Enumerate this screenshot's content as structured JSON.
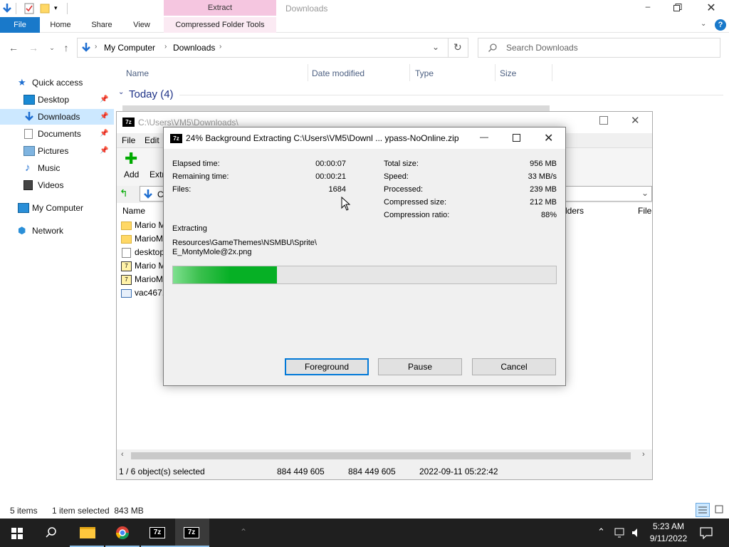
{
  "explorer": {
    "ribbon_context_label": "Extract",
    "window_title": "Downloads",
    "tabs": [
      "File",
      "Home",
      "Share",
      "View",
      "Compressed Folder Tools"
    ],
    "breadcrumb": [
      "My Computer",
      "Downloads"
    ],
    "search_placeholder": "Search Downloads",
    "columns": [
      "Name",
      "Date modified",
      "Type",
      "Size"
    ],
    "group_label": "Today (4)",
    "nav": {
      "quick_access": "Quick access",
      "items": [
        "Desktop",
        "Downloads",
        "Documents",
        "Pictures",
        "Music",
        "Videos"
      ],
      "my_computer": "My Computer",
      "network": "Network"
    },
    "status": {
      "items": "5 items",
      "selected": "1 item selected  843 MB"
    }
  },
  "sevenzip": {
    "title": "C:\\Users\\VM5\\Downloads\\",
    "menu": [
      "File",
      "Edit"
    ],
    "toolbar": {
      "add": "Add",
      "extract": "Extr"
    },
    "path_short": "C",
    "name_header": "Name",
    "folders_header": "lders",
    "file_header": "File",
    "files": [
      "Mario M",
      "MarioM",
      "desktop",
      "Mario M",
      "MarioM",
      "vac467.e"
    ],
    "status": {
      "selected": "1 / 6 object(s) selected",
      "size": "884 449 605",
      "packed": "884 449 605",
      "modified": "2022-09-11 05:22:42"
    }
  },
  "dialog": {
    "title": "24% Background Extracting C:\\Users\\VM5\\Downl ... ypass-NoOnline.zip",
    "progress_percent": 24,
    "stats_left": [
      {
        "label": "Elapsed time:",
        "value": "00:00:07"
      },
      {
        "label": "Remaining time:",
        "value": "00:00:21"
      },
      {
        "label": "Files:",
        "value": "1684"
      }
    ],
    "stats_right": [
      {
        "label": "Total size:",
        "value": "956 MB"
      },
      {
        "label": "Speed:",
        "value": "33 MB/s"
      },
      {
        "label": "Processed:",
        "value": "239 MB"
      },
      {
        "label": "Compressed size:",
        "value": "212 MB"
      },
      {
        "label": "Compression ratio:",
        "value": "88%"
      }
    ],
    "action": "Extracting",
    "current_path_line1": "Resources\\GameThemes\\NSMBU\\Sprite\\",
    "current_path_line2": "E_MontyMole@2x.png",
    "buttons": {
      "foreground": "Foreground",
      "pause": "Pause",
      "cancel": "Cancel"
    }
  },
  "taskbar": {
    "time": "5:23 AM",
    "date": "9/11/2022"
  }
}
